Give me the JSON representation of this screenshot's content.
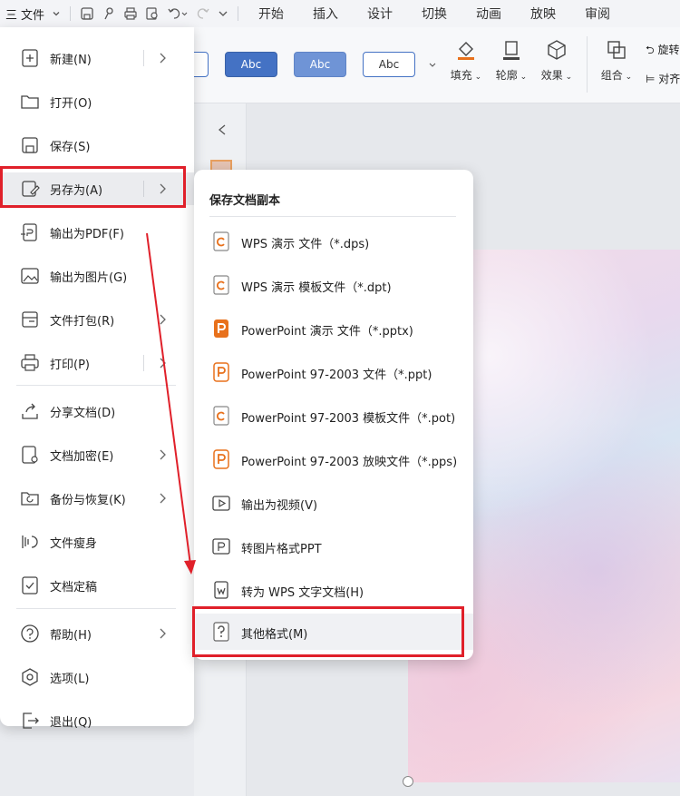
{
  "colors": {
    "accent_red": "#e0202a",
    "style_blue": "#4472c4",
    "pptx_orange": "#e8711c"
  },
  "topbar": {
    "menu_glyph": "三",
    "file_label": "文件",
    "tabs": [
      "开始",
      "插入",
      "设计",
      "切换",
      "动画",
      "放映",
      "审阅"
    ]
  },
  "ribbon": {
    "style_buttons": [
      "Abc",
      "Abc",
      "Abc"
    ],
    "tools": [
      {
        "label": "填充",
        "icon": "fill-bucket-icon"
      },
      {
        "label": "轮廓",
        "icon": "outline-icon"
      },
      {
        "label": "效果",
        "icon": "effect-cube-icon"
      },
      {
        "label": "组合",
        "icon": "group-icon"
      }
    ],
    "right_partial": [
      "旋转",
      "对齐"
    ]
  },
  "file_menu": {
    "items": [
      {
        "label": "新建(N)",
        "icon": "new-file-icon",
        "submenu": true
      },
      {
        "label": "打开(O)",
        "icon": "folder-open-icon",
        "submenu": false
      },
      {
        "label": "保存(S)",
        "icon": "save-icon",
        "submenu": false
      },
      {
        "label": "另存为(A)",
        "icon": "save-as-icon",
        "submenu": true
      },
      {
        "label": "输出为PDF(F)",
        "icon": "export-pdf-icon",
        "submenu": false
      },
      {
        "label": "输出为图片(G)",
        "icon": "export-image-icon",
        "submenu": false
      },
      {
        "label": "文件打包(R)",
        "icon": "package-icon",
        "submenu": true
      },
      {
        "label": "打印(P)",
        "icon": "print-icon",
        "submenu": true
      },
      {
        "label": "分享文档(D)",
        "icon": "share-icon",
        "submenu": false
      },
      {
        "label": "文档加密(E)",
        "icon": "encrypt-icon",
        "submenu": true
      },
      {
        "label": "备份与恢复(K)",
        "icon": "backup-icon",
        "submenu": true
      },
      {
        "label": "文件瘦身",
        "icon": "slim-icon",
        "submenu": false
      },
      {
        "label": "文档定稿",
        "icon": "finalize-icon",
        "submenu": false
      },
      {
        "label": "帮助(H)",
        "icon": "help-icon",
        "submenu": true
      },
      {
        "label": "选项(L)",
        "icon": "options-icon",
        "submenu": false
      },
      {
        "label": "退出(Q)",
        "icon": "exit-icon",
        "submenu": false
      }
    ]
  },
  "save_as_submenu": {
    "title": "保存文档副本",
    "items": [
      {
        "label": "WPS 演示 文件（*.dps)",
        "icon": "wps-dps-icon"
      },
      {
        "label": "WPS 演示 模板文件（*.dpt)",
        "icon": "wps-dpt-icon"
      },
      {
        "label": "PowerPoint 演示 文件（*.pptx)",
        "icon": "pptx-icon"
      },
      {
        "label": "PowerPoint 97-2003 文件（*.ppt)",
        "icon": "ppt-icon"
      },
      {
        "label": "PowerPoint 97-2003 模板文件（*.pot)",
        "icon": "pot-icon"
      },
      {
        "label": "PowerPoint 97-2003 放映文件（*.pps)",
        "icon": "pps-icon"
      },
      {
        "label": "输出为视频(V)",
        "icon": "video-export-icon"
      },
      {
        "label": "转图片格式PPT",
        "icon": "image-ppt-icon"
      },
      {
        "label": "转为 WPS 文字文档(H)",
        "icon": "to-wps-doc-icon"
      },
      {
        "label": "其他格式(M)",
        "icon": "other-format-icon"
      }
    ]
  }
}
